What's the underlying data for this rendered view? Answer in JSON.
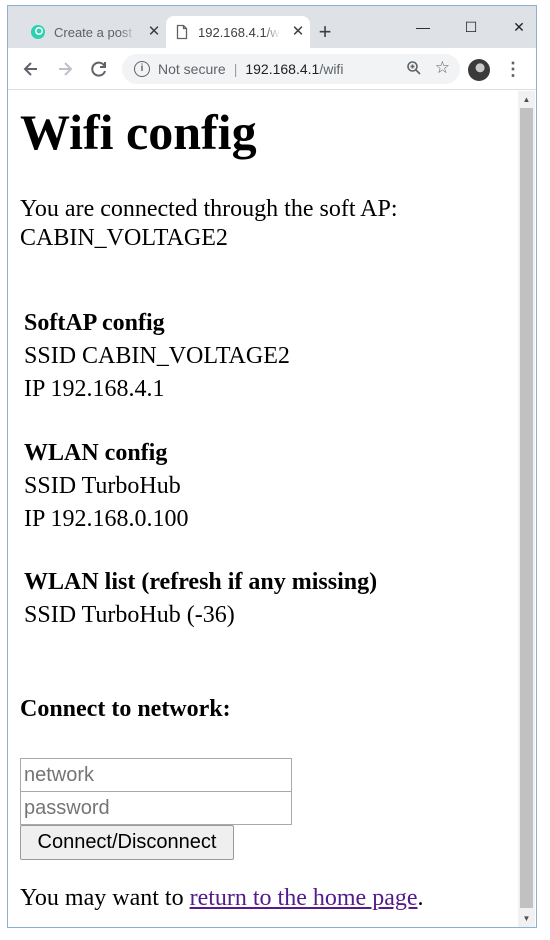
{
  "browser": {
    "tabs": [
      {
        "title": "Create a post",
        "close": "✕",
        "active": false
      },
      {
        "title": "192.168.4.1/wifi",
        "close": "✕",
        "active": true
      }
    ],
    "new_tab": "+",
    "window_controls": {
      "minimize": "—",
      "maximize": "☐",
      "close": "✕"
    },
    "security_label": "Not secure",
    "separator": "|",
    "url_host": "192.168.4.1",
    "url_path": "/wifi"
  },
  "page": {
    "title": "Wifi config",
    "intro_line1": "You are connected through the soft AP:",
    "intro_line2": "CABIN_VOLTAGE2",
    "softap": {
      "heading": "SoftAP config",
      "ssid": "SSID CABIN_VOLTAGE2",
      "ip": "IP 192.168.4.1"
    },
    "wlan": {
      "heading": "WLAN config",
      "ssid": "SSID TurboHub",
      "ip": "IP 192.168.0.100"
    },
    "wlan_list": {
      "heading": "WLAN list (refresh if any missing)",
      "items": [
        "SSID TurboHub (-36)"
      ]
    },
    "connect_heading": "Connect to network:",
    "form": {
      "network_placeholder": "network",
      "password_placeholder": "password",
      "submit_label": "Connect/Disconnect"
    },
    "footer": {
      "prefix": "You may want to ",
      "link_text": "return to the home page",
      "suffix": "."
    }
  },
  "colors": {
    "link": "#551a8b",
    "tabstrip": "#dee1e6",
    "favicon": "#2bd1b0"
  }
}
